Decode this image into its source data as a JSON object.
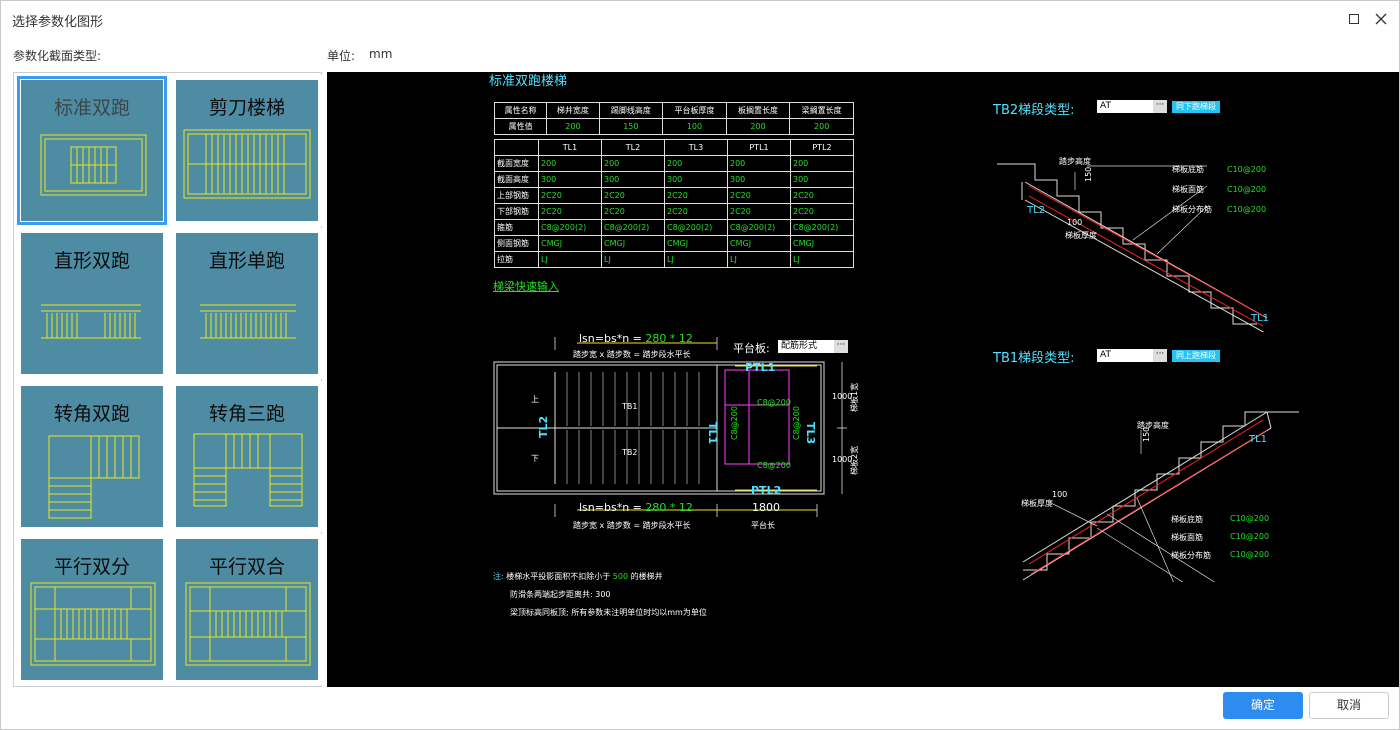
{
  "window": {
    "title": "选择参数化图形"
  },
  "labels": {
    "section_type": "参数化截面类型:",
    "unit_label": "单位:",
    "unit_value": "mm"
  },
  "gallery": [
    {
      "name": "标准双跑",
      "selected": true
    },
    {
      "name": "剪刀楼梯",
      "selected": false
    },
    {
      "name": "直形双跑",
      "selected": false
    },
    {
      "name": "直形单跑",
      "selected": false
    },
    {
      "name": "转角双跑",
      "selected": false
    },
    {
      "name": "转角三跑",
      "selected": false
    },
    {
      "name": "平行双分",
      "selected": false
    },
    {
      "name": "平行双合",
      "selected": false
    }
  ],
  "preview": {
    "heading": "标准双跑楼梯",
    "attr_table": {
      "headers": [
        "属性名称",
        "梯井宽度",
        "踢脚线高度",
        "平台板厚度",
        "板搁置长度",
        "梁搁置长度"
      ],
      "row_label": "属性值",
      "values": [
        "200",
        "150",
        "100",
        "200",
        "200"
      ]
    },
    "beam_table": {
      "headers": [
        "TL1",
        "TL2",
        "TL3",
        "PTL1",
        "PTL2"
      ],
      "rows": [
        {
          "label": "截面宽度",
          "values": [
            "200",
            "200",
            "200",
            "200",
            "200"
          ]
        },
        {
          "label": "截面高度",
          "values": [
            "300",
            "300",
            "300",
            "300",
            "300"
          ]
        },
        {
          "label": "上部钢筋",
          "values": [
            "2C20",
            "2C20",
            "2C20",
            "2C20",
            "2C20"
          ]
        },
        {
          "label": "下部钢筋",
          "values": [
            "2C20",
            "2C20",
            "2C20",
            "2C20",
            "2C20"
          ]
        },
        {
          "label": "箍筋",
          "values": [
            "C8@200(2)",
            "C8@200(2)",
            "C8@200(2)",
            "C8@200(2)",
            "C8@200(2)"
          ]
        },
        {
          "label": "侧面钢筋",
          "values": [
            "CMGJ",
            "CMGJ",
            "CMGJ",
            "CMGJ",
            "CMGJ"
          ]
        },
        {
          "label": "拉筋",
          "values": [
            "LJ",
            "LJ",
            "LJ",
            "LJ",
            "LJ"
          ]
        }
      ]
    },
    "quick_input_link": "梯梁快速输入",
    "plan": {
      "formula_top": "lsn=bs*n =",
      "formula_top_values": "280 * 12",
      "formula_caption": "踏步宽 x 踏步数 = 踏步段水平长",
      "formula_bottom": "lsn=bs*n =",
      "formula_bottom_values": "280 * 12",
      "platform_label": "平台板:",
      "platform_combo": "配筋形式",
      "platform_width": "1800",
      "platform_width_caption": "平台长",
      "tb1": "TB1",
      "tb2": "TB2",
      "up": "上",
      "down": "下",
      "tl1": "TL1",
      "tl2": "TL2",
      "tl3": "TL3",
      "ptl1": "PTL1",
      "ptl2": "PTL2",
      "rebar1": "C8@200",
      "rebar2": "C8@200",
      "rebar3": "C8@200",
      "rebar4": "C8@200",
      "dim1": "1000",
      "dim2": "1000",
      "dim1_caption": "梯板1宽",
      "dim2_caption": "梯板2宽"
    },
    "notes": {
      "prefix": "注:",
      "line1_a": "楼梯水平投影面积不扣除小于",
      "line1_num": "500",
      "line1_b": "的楼梯井",
      "line2": "防滑条两端起步距离共: 300",
      "line3": "梁顶标高同板顶; 所有参数未注明单位时均以mm为单位"
    },
    "tb2": {
      "label": "TB2梯段类型:",
      "combo": "AT",
      "button": "同下跑梯段",
      "step_height": "踏步高度",
      "h150": "150",
      "w100": "100",
      "thickness": "梯板厚度",
      "bottom": "梯板底筋",
      "top": "梯板面筋",
      "dist": "梯板分布筋",
      "bottom_val": "C10@200",
      "top_val": "C10@200",
      "dist_val": "C10@200",
      "tl_low": "TL2",
      "tl_high": "TL1"
    },
    "tb1": {
      "label": "TB1梯段类型:",
      "combo": "AT",
      "button": "同上跑梯段",
      "step_height": "踏步高度",
      "h150": "150",
      "w100": "100",
      "thickness": "梯板厚度",
      "bottom": "梯板底筋",
      "top": "梯板面筋",
      "dist": "梯板分布筋",
      "bottom_val": "C10@200",
      "top_val": "C10@200",
      "dist_val": "C10@200",
      "tl_high": "TL1"
    }
  },
  "buttons": {
    "ok": "确定",
    "cancel": "取消"
  }
}
